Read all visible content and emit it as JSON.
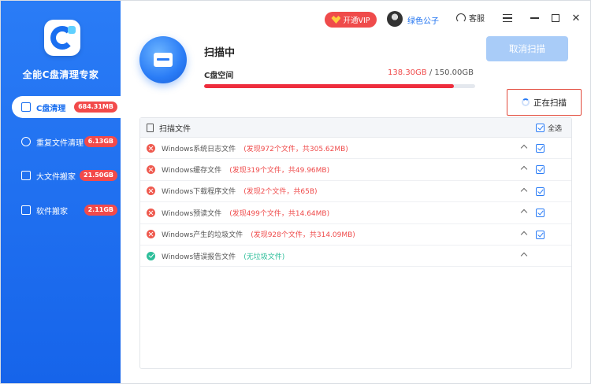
{
  "app": {
    "title": "全能C盘清理专家"
  },
  "topbar": {
    "vip_label": "开通VIP",
    "username": "绿色公子",
    "service_label": "客服"
  },
  "sidebar": {
    "items": [
      {
        "label": "C盘清理",
        "badge": "684.31MB",
        "active": true,
        "icon": "disk-icon"
      },
      {
        "label": "重复文件清理",
        "badge": "6.13GB",
        "active": false,
        "icon": "duplicate-icon"
      },
      {
        "label": "大文件搬家",
        "badge": "21.50GB",
        "active": false,
        "icon": "move-file-icon"
      },
      {
        "label": "软件搬家",
        "badge": "2.11GB",
        "active": false,
        "icon": "software-icon"
      }
    ]
  },
  "scan": {
    "title": "扫描中",
    "space_label": "C盘空间",
    "used": "138.30GB",
    "separator": " / ",
    "total": "150.00GB",
    "progress_percent": 92.2,
    "cancel_label": "取消扫描",
    "status_label": "正在扫描"
  },
  "panel": {
    "header_label": "扫描文件",
    "select_all_label": "全选",
    "rows": [
      {
        "name": "Windows系统日志文件",
        "detail": "(发现972个文件，共305.62MB)",
        "status": "error",
        "checked": true
      },
      {
        "name": "Windows缓存文件",
        "detail": "(发现319个文件，共49.96MB)",
        "status": "error",
        "checked": true
      },
      {
        "name": "Windows下载程序文件",
        "detail": "(发现2个文件，共65B)",
        "status": "error",
        "checked": true
      },
      {
        "name": "Windows预读文件",
        "detail": "(发现499个文件，共14.64MB)",
        "status": "error",
        "checked": true
      },
      {
        "name": "Windows产生的垃圾文件",
        "detail": "(发现928个文件，共314.09MB)",
        "status": "error",
        "checked": true
      },
      {
        "name": "Windows错误报告文件",
        "detail": "(无垃圾文件)",
        "status": "ok",
        "checked": false
      }
    ]
  },
  "colors": {
    "accent": "#1a6ff0",
    "danger": "#ef4b4b",
    "success": "#2dbe9a"
  }
}
